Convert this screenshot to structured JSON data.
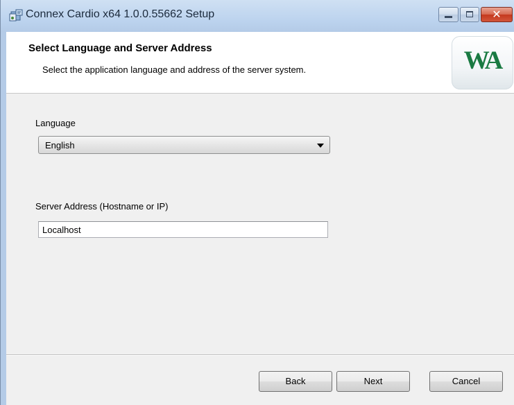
{
  "window": {
    "title": "Connex Cardio x64 1.0.0.55662 Setup",
    "close_glyph": "✕"
  },
  "header": {
    "title": "Select Language and Server Address",
    "subtitle": "Select the application language and address of the server system.",
    "logo_text": "WA"
  },
  "form": {
    "language_label": "Language",
    "language_value": "English",
    "server_label": "Server Address (Hostname or IP)",
    "server_value": "Localhost"
  },
  "buttons": {
    "back": "Back",
    "next": "Next",
    "cancel": "Cancel"
  },
  "icons": {
    "app": "installer-icon",
    "minimize": "minimize-icon",
    "maximize": "maximize-icon",
    "close": "close-icon",
    "dropdown": "chevron-down-icon"
  },
  "colors": {
    "logo_green": "#1a7a42",
    "close_button": "#c4391e",
    "title_bar": "#bcd3ee"
  }
}
